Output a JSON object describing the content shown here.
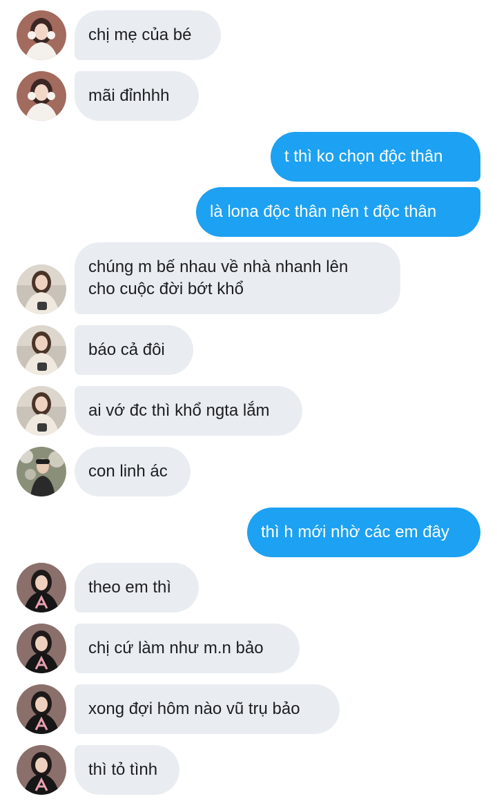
{
  "conversation": {
    "messages": [
      {
        "id": 1,
        "sender": "incoming",
        "avatar": "girl-white-top",
        "text": "chị mẹ của bé"
      },
      {
        "id": 2,
        "sender": "incoming",
        "avatar": "girl-white-top",
        "text": "mãi đỉnhhh"
      },
      {
        "id": 3,
        "sender": "outgoing",
        "text": "t thì ko chọn độc thân"
      },
      {
        "id": 4,
        "sender": "outgoing",
        "text": "là lona độc thân nên t độc thân"
      },
      {
        "id": 5,
        "sender": "incoming",
        "avatar": "girl-sweater",
        "text_line1": "chúng m bế nhau về nhà nhanh lên",
        "text_line2": "cho cuộc đời bớt khổ"
      },
      {
        "id": 6,
        "sender": "incoming",
        "avatar": "girl-sweater",
        "text": "báo cả đôi"
      },
      {
        "id": 7,
        "sender": "incoming",
        "avatar": "girl-sweater",
        "text": "ai vớ đc thì khổ ngta lắm"
      },
      {
        "id": 8,
        "sender": "incoming",
        "avatar": "person-outdoor",
        "text": "con linh ác"
      },
      {
        "id": 9,
        "sender": "outgoing",
        "text": "thì h mới nhờ các em đây"
      },
      {
        "id": 10,
        "sender": "incoming",
        "avatar": "girl-black-tee",
        "text": "theo em thì"
      },
      {
        "id": 11,
        "sender": "incoming",
        "avatar": "girl-black-tee",
        "text": "chị cứ làm như m.n bảo"
      },
      {
        "id": 12,
        "sender": "incoming",
        "avatar": "girl-black-tee",
        "text": "xong đợi hôm nào vũ trụ bảo"
      },
      {
        "id": 13,
        "sender": "incoming",
        "avatar": "girl-black-tee",
        "text": "thì tỏ tình"
      }
    ]
  },
  "colors": {
    "incoming_bubble": "#e9edf1",
    "outgoing_bubble": "#1da1f2",
    "incoming_text": "#1c1e21",
    "outgoing_text": "#ffffff"
  }
}
